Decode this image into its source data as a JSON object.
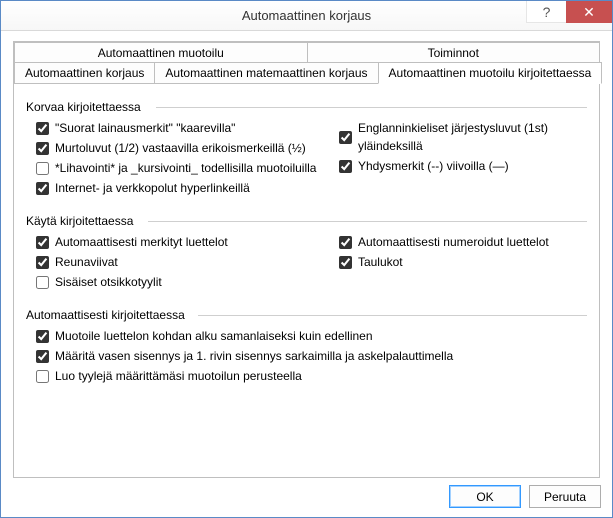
{
  "window": {
    "title": "Automaattinen korjaus",
    "help_icon": "?",
    "close_icon": "✕"
  },
  "tabs": {
    "top": [
      {
        "label": "Automaattinen muotoilu"
      },
      {
        "label": "Toiminnot"
      }
    ],
    "bottom": [
      {
        "label": "Automaattinen korjaus"
      },
      {
        "label": "Automaattinen matemaattinen korjaus"
      },
      {
        "label": "Automaattinen muotoilu kirjoitettaessa",
        "active": true
      }
    ]
  },
  "groups": {
    "replace": {
      "title": "Korvaa kirjoitettaessa",
      "left": [
        {
          "label": "\"Suorat lainausmerkit\" \"kaarevilla\"",
          "checked": true
        },
        {
          "label": "Murtoluvut (1/2) vastaavilla erikoismerkeillä (½)",
          "checked": true
        },
        {
          "label": "*Lihavointi* ja _kursivointi_ todellisilla muotoiluilla",
          "checked": false
        },
        {
          "label": "Internet- ja verkkopolut hyperlinkeillä",
          "checked": true
        }
      ],
      "right": [
        {
          "label": "Englanninkieliset järjestysluvut (1st) yläindeksillä",
          "checked": true
        },
        {
          "label": "Yhdysmerkit (--) viivoilla (—)",
          "checked": true
        }
      ]
    },
    "apply": {
      "title": "Käytä kirjoitettaessa",
      "left": [
        {
          "label": "Automaattisesti merkityt luettelot",
          "checked": true
        },
        {
          "label": "Reunaviivat",
          "checked": true
        },
        {
          "label": "Sisäiset otsikkotyylit",
          "checked": false
        }
      ],
      "right": [
        {
          "label": "Automaattisesti numeroidut luettelot",
          "checked": true
        },
        {
          "label": "Taulukot",
          "checked": true
        }
      ]
    },
    "auto": {
      "title": "Automaattisesti kirjoitettaessa",
      "items": [
        {
          "label": "Muotoile luettelon kohdan alku samanlaiseksi kuin edellinen",
          "checked": true
        },
        {
          "label": "Määritä vasen sisennys ja 1. rivin sisennys sarkaimilla ja askelpalauttimella",
          "checked": true
        },
        {
          "label": "Luo tyylejä määrittämäsi muotoilun perusteella",
          "checked": false
        }
      ]
    }
  },
  "buttons": {
    "ok": "OK",
    "cancel": "Peruuta"
  }
}
